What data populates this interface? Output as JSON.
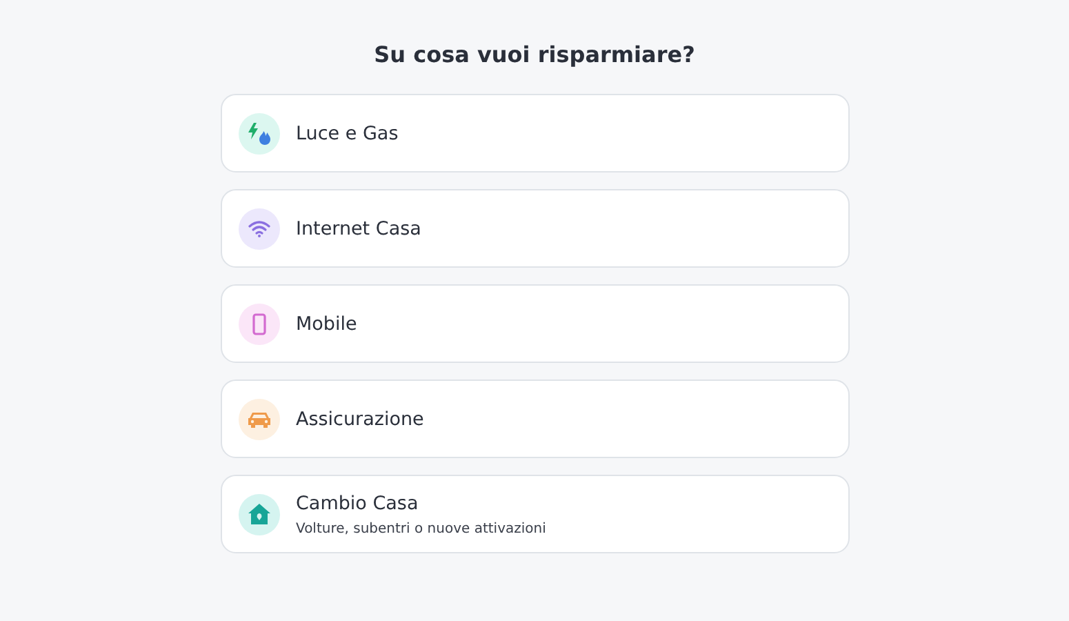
{
  "title": "Su cosa vuoi risparmiare?",
  "options": [
    {
      "kind": "energy",
      "label": "Luce e Gas"
    },
    {
      "kind": "wifi",
      "label": "Internet Casa"
    },
    {
      "kind": "phone",
      "label": "Mobile"
    },
    {
      "kind": "car",
      "label": "Assicurazione"
    },
    {
      "kind": "house",
      "label": "Cambio Casa",
      "subtitle": "Volture, subentri o nuove attivazioni"
    }
  ]
}
